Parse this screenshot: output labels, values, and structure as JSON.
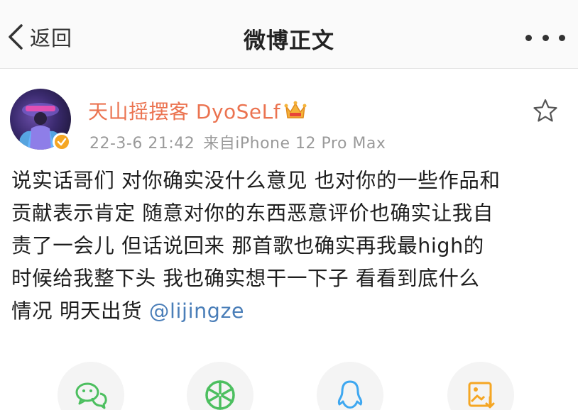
{
  "navbar": {
    "back_label": "返回",
    "title": "微博正文",
    "more_icon": "more-dots-icon"
  },
  "post": {
    "username": "天山摇摆客 DyoSeLf",
    "vip_icon": "crown-icon",
    "date": "22-3-6 21:42",
    "source": "来自iPhone 12 Pro Max",
    "content_lines": [
      "说实话哥们 对你确实没什么意见 也对你的一些作品和",
      "贡献表示肯定 随意对你的东西恶意评价也确实让我自",
      "责了一会儿 但话说回来 那首歌也确实再我最high的",
      "时候给我整下头  我也确实想干一下子 看看到底什么",
      "情况 明天出货 "
    ],
    "mention": "@lijingze"
  },
  "share": {
    "items": [
      {
        "name": "wechat",
        "icon": "wechat-icon",
        "color": "#4cbf5f"
      },
      {
        "name": "moments",
        "icon": "aperture-icon",
        "color": "#4cbf5f"
      },
      {
        "name": "qq",
        "icon": "qq-penguin-icon",
        "color": "#3ea7f0"
      },
      {
        "name": "save-image",
        "icon": "save-image-icon",
        "color": "#f5a623"
      }
    ]
  },
  "colors": {
    "username": "#eb7350",
    "mention": "#4a7eb8",
    "meta": "#9a9a9a",
    "accent": "#f5a623"
  }
}
